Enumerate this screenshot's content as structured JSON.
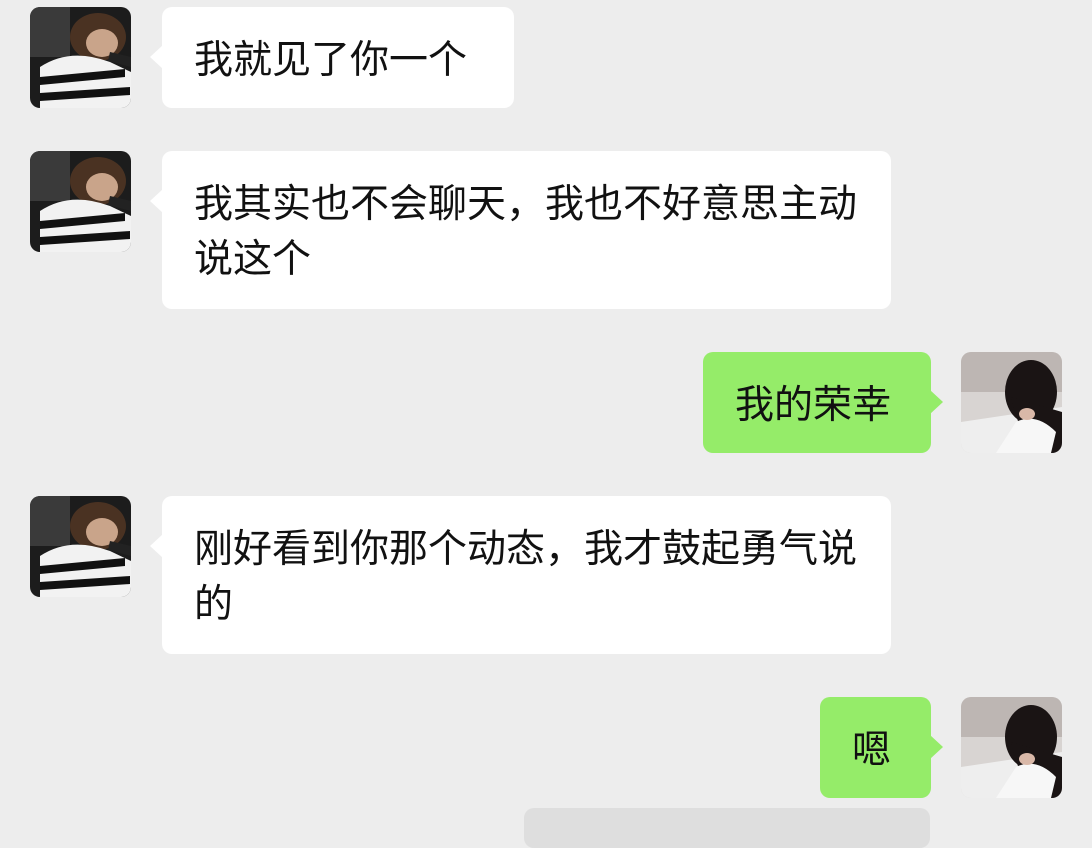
{
  "chat": {
    "messages": [
      {
        "sender": "other",
        "text": "我就见了你一个"
      },
      {
        "sender": "other",
        "text": "我其实也不会聊天，我也不好意思主动说这个"
      },
      {
        "sender": "me",
        "text": "我的荣幸"
      },
      {
        "sender": "other",
        "text": "刚好看到你那个动态，我才鼓起勇气说的"
      },
      {
        "sender": "me",
        "text": "嗯"
      }
    ]
  },
  "colors": {
    "background": "#ededed",
    "incoming_bubble": "#ffffff",
    "outgoing_bubble": "#95ec69",
    "text": "#111111"
  },
  "icons": {
    "other_avatar": "avatar-photo-boy",
    "my_avatar": "avatar-photo-girl"
  }
}
